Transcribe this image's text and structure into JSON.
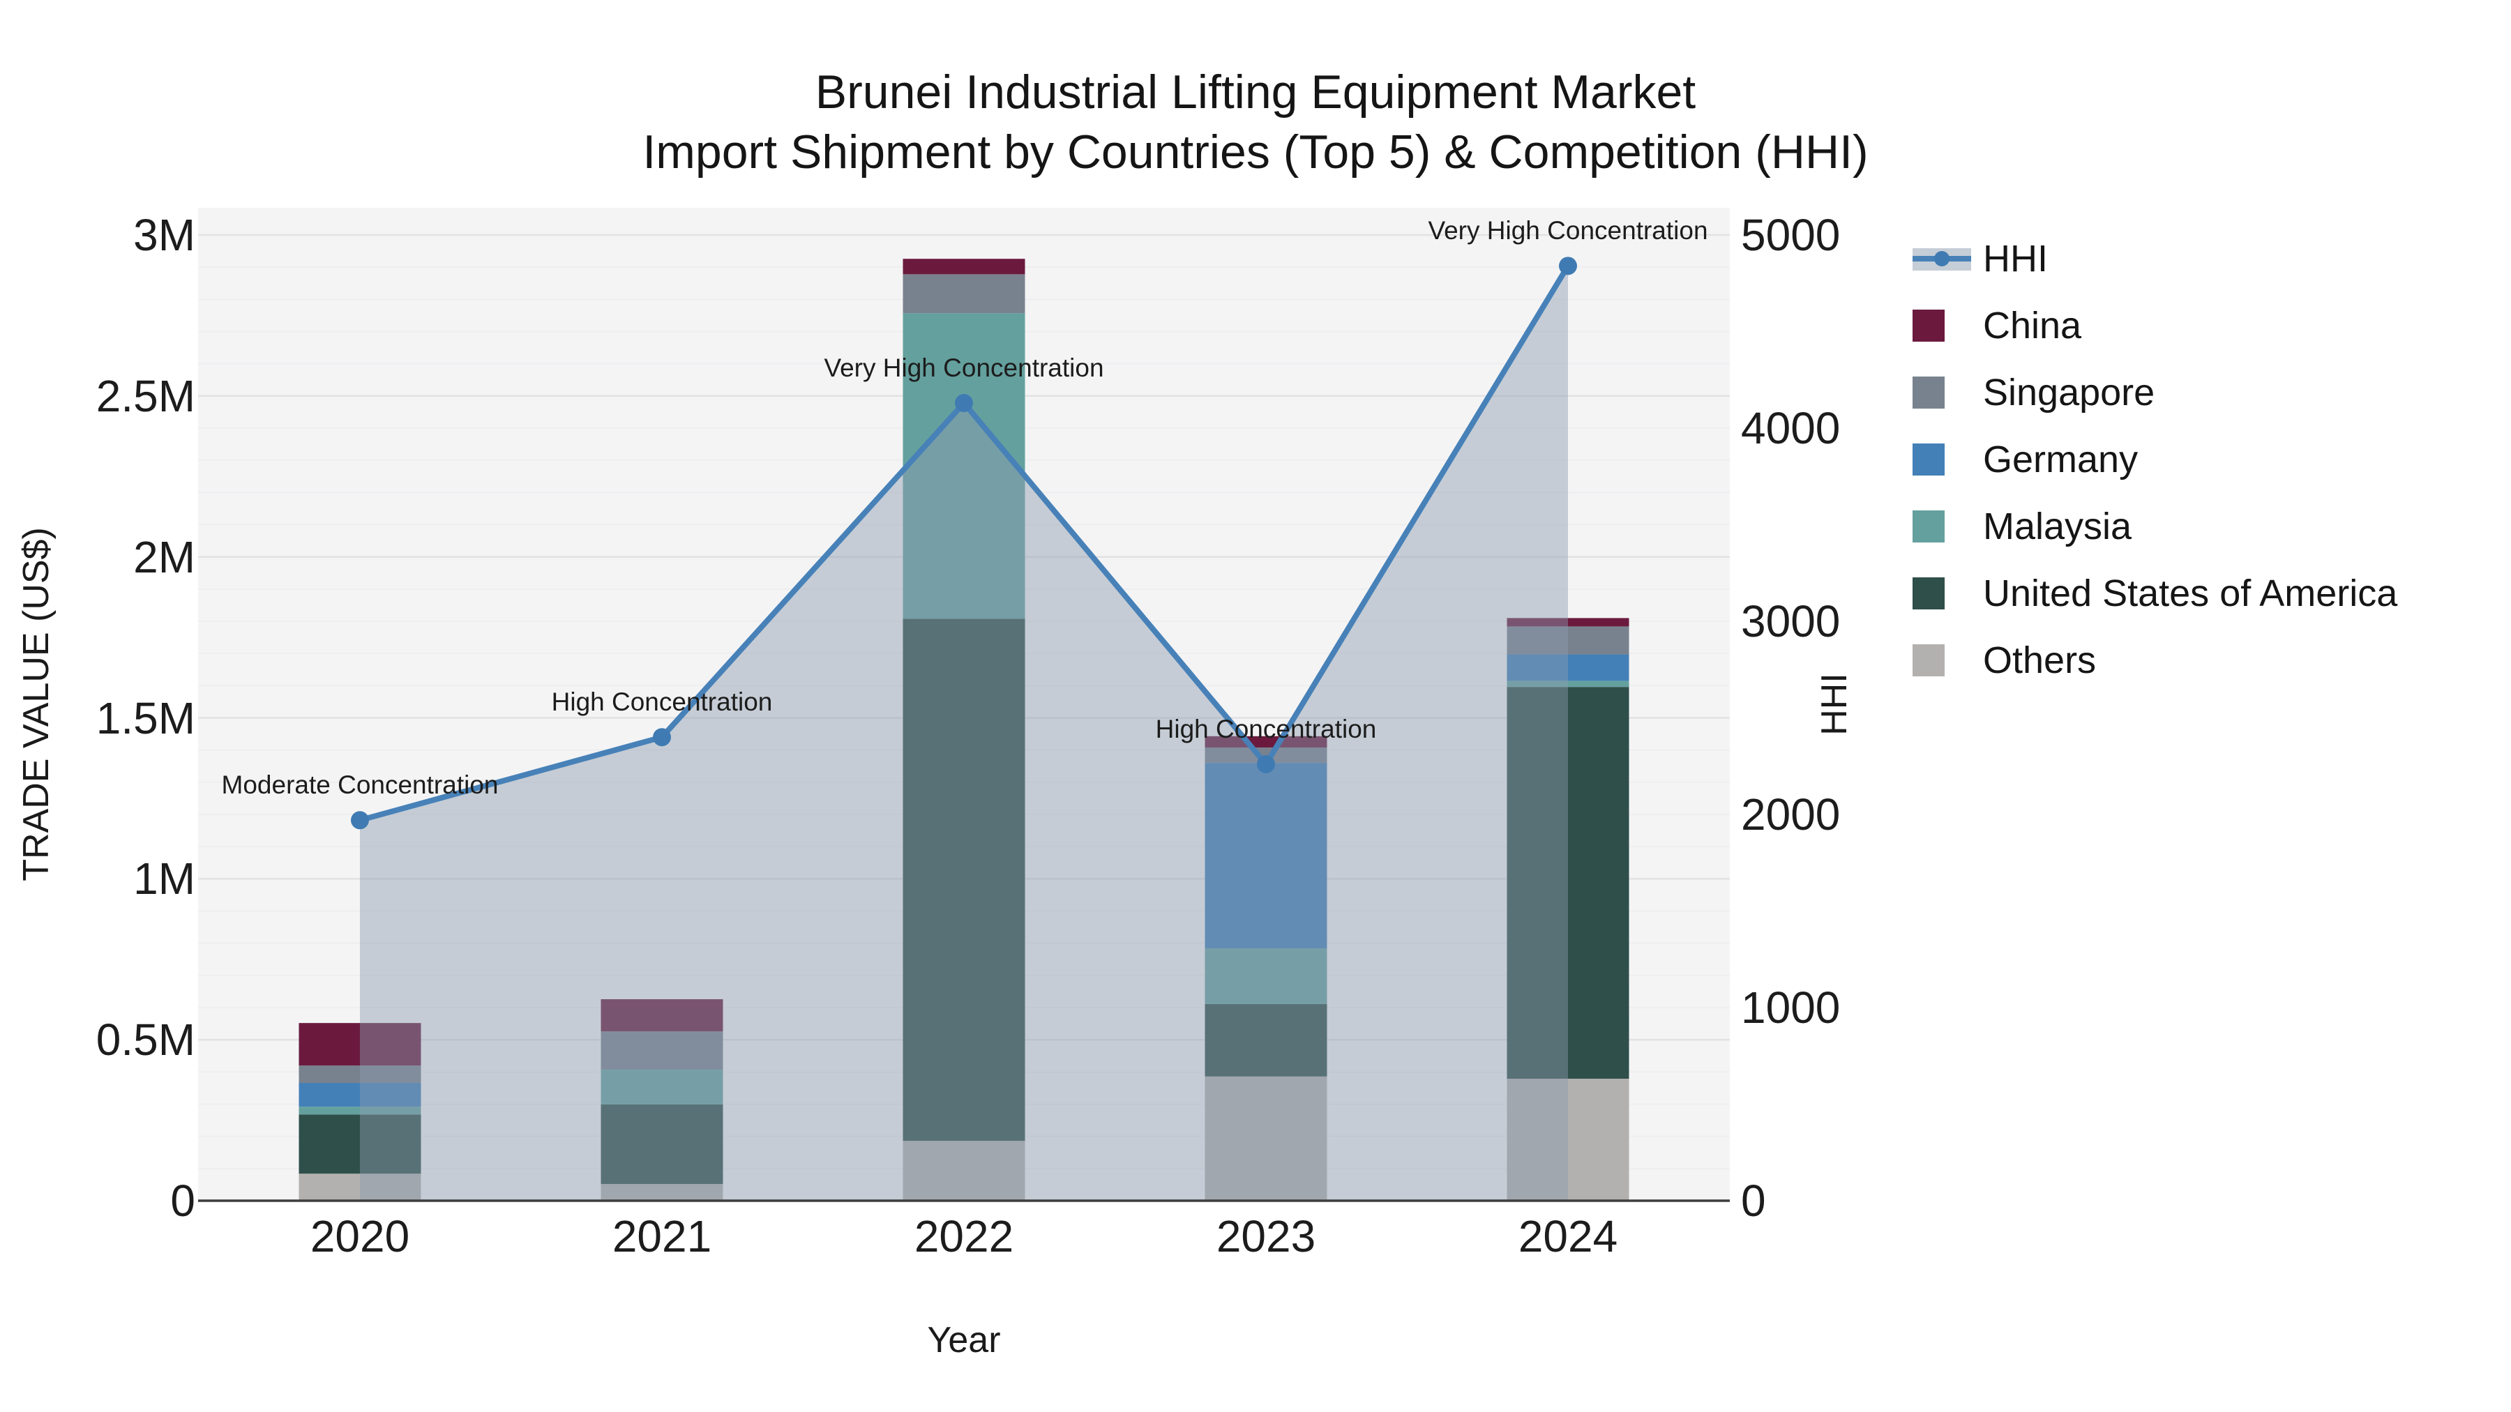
{
  "title": {
    "line1": "Brunei Industrial Lifting Equipment Market",
    "line2": "Import Shipment by Countries (Top 5) & Competition (HHI)"
  },
  "x_axis": {
    "label": "Year",
    "categories": [
      "2020",
      "2021",
      "2022",
      "2023",
      "2024"
    ]
  },
  "y_axis_left": {
    "label": "TRADE VALUE (US$)",
    "ticks": [
      {
        "label": "0",
        "value": 0
      },
      {
        "label": "0.5M",
        "value": 500000
      },
      {
        "label": "1M",
        "value": 1000000
      },
      {
        "label": "1.5M",
        "value": 1500000
      },
      {
        "label": "2M",
        "value": 2000000
      },
      {
        "label": "2.5M",
        "value": 2500000
      },
      {
        "label": "3M",
        "value": 3000000
      }
    ],
    "range": [
      0,
      3000000
    ]
  },
  "y_axis_right": {
    "label": "HHI",
    "ticks": [
      {
        "label": "0",
        "value": 0
      },
      {
        "label": "1000",
        "value": 1000
      },
      {
        "label": "2000",
        "value": 2000
      },
      {
        "label": "3000",
        "value": 3000
      },
      {
        "label": "4000",
        "value": 4000
      },
      {
        "label": "5000",
        "value": 5000
      }
    ],
    "range": [
      0,
      5000
    ]
  },
  "legend": {
    "hhi_label": "HHI",
    "items": [
      {
        "label": "China",
        "color": "#6b1a3e"
      },
      {
        "label": "Singapore",
        "color": "#78828f"
      },
      {
        "label": "Germany",
        "color": "#4380b8"
      },
      {
        "label": "Malaysia",
        "color": "#64a09e"
      },
      {
        "label": "United States of America",
        "color": "#2f4f4a"
      },
      {
        "label": "Others",
        "color": "#b3b1af"
      }
    ]
  },
  "colors": {
    "hhi_line": "#4781b8",
    "hhi_marker": "#3f7bb2",
    "hhi_area": "#8c9bb0",
    "hhi_area_opacity": 0.45,
    "plot_background": "#f4f4f5",
    "gridline_major": "#e2e2e5",
    "gridline_minor": "#eeeef0",
    "axis_line": "#3d3d3d"
  },
  "chart_data": {
    "type": "stacked-bar+line",
    "title": "Brunei Industrial Lifting Equipment Market — Import Shipment by Countries (Top 5) & Competition (HHI)",
    "categories": [
      "2020",
      "2021",
      "2022",
      "2023",
      "2024"
    ],
    "bar_unit": "US$",
    "bar_ylim": [
      0,
      3000000
    ],
    "series": [
      {
        "name": "China",
        "color": "#6b1a3e",
        "values": [
          132000,
          100000,
          48000,
          35000,
          26000
        ]
      },
      {
        "name": "Singapore",
        "color": "#78828f",
        "values": [
          54000,
          119000,
          121000,
          48000,
          87000
        ]
      },
      {
        "name": "Germany",
        "color": "#4380b8",
        "values": [
          74000,
          0,
          0,
          576000,
          82000
        ]
      },
      {
        "name": "Malaysia",
        "color": "#64a09e",
        "values": [
          24000,
          108000,
          949000,
          173000,
          19000
        ]
      },
      {
        "name": "United States of America",
        "color": "#2f4f4a",
        "values": [
          184000,
          247000,
          1622000,
          225000,
          1217000
        ]
      },
      {
        "name": "Others",
        "color": "#b3b1af",
        "values": [
          84000,
          52000,
          186000,
          386000,
          379000
        ]
      }
    ],
    "bar_totals": [
      552000,
      626000,
      2926000,
      1443000,
      1810000
    ],
    "line_series": {
      "name": "HHI",
      "ylim": [
        0,
        5000
      ],
      "values": [
        1970,
        2400,
        4130,
        2260,
        4840
      ]
    },
    "annotations": [
      {
        "year": "2020",
        "text": "Moderate Concentration"
      },
      {
        "year": "2021",
        "text": "High Concentration"
      },
      {
        "year": "2022",
        "text": "Very High Concentration"
      },
      {
        "year": "2023",
        "text": "High Concentration"
      },
      {
        "year": "2024",
        "text": "Very High Concentration"
      }
    ],
    "legend_position": "upper-right-outside",
    "grid": "horizontal, major every 0.5M, minor every 0.1M"
  }
}
